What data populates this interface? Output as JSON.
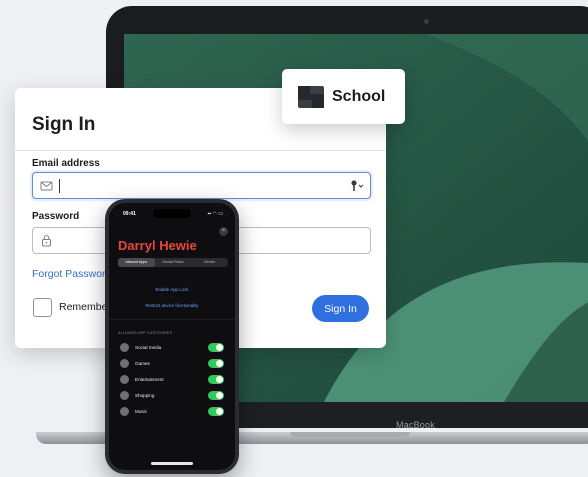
{
  "laptop": {
    "brand": "MacBook"
  },
  "signin": {
    "title": "Sign In",
    "email_label": "Email address",
    "email_value": "",
    "password_label": "Password",
    "password_value": "",
    "forgot_link": "Forgot Password",
    "remember_label": "Remember me",
    "submit_label": "Sign In"
  },
  "school_badge": {
    "name": "School"
  },
  "phone": {
    "status_time": "09:41",
    "status_icons": "▪▪ ◠ ▭",
    "close_label": "×",
    "child_name": "Darryl Hewie",
    "tabs": [
      {
        "label": "Allowed Apps",
        "active": true
      },
      {
        "label": "Device Rules",
        "active": false
      },
      {
        "label": "Device",
        "active": false
      }
    ],
    "links": {
      "app_lock": "Enable App Lock",
      "restrict": "Restrict device functionality"
    },
    "section_header": "ALLOWED APP CATEGORIES",
    "categories": [
      {
        "label": "Social media",
        "enabled": true
      },
      {
        "label": "Games",
        "enabled": true
      },
      {
        "label": "Entertainment",
        "enabled": true
      },
      {
        "label": "Shopping",
        "enabled": true
      },
      {
        "label": "Music",
        "enabled": true
      }
    ]
  },
  "colors": {
    "accent": "#2f6fe0",
    "child_name": "#e8473b",
    "toggle_on": "#34c759",
    "screen_green": "#2c5c4a"
  },
  "icons": {
    "email": "envelope-icon",
    "password": "lock-icon",
    "autofill": "key-icon",
    "logo": "school-logo-icon"
  }
}
